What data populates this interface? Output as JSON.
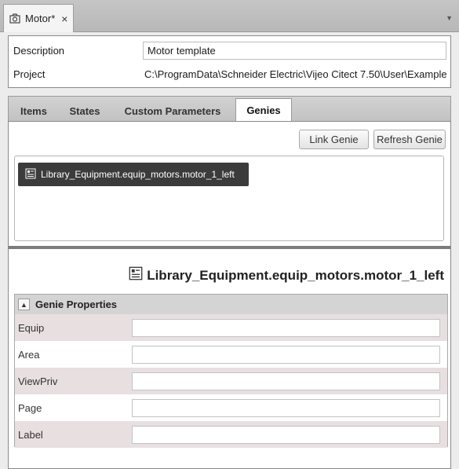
{
  "document_tab": {
    "title": "Motor*",
    "close": "×"
  },
  "info": {
    "description_label": "Description",
    "description_value": "Motor template",
    "project_label": "Project",
    "project_value": "C:\\ProgramData\\Schneider Electric\\Vijeo Citect 7.50\\User\\Example"
  },
  "tabs": [
    {
      "label": "Items"
    },
    {
      "label": "States"
    },
    {
      "label": "Custom Parameters"
    },
    {
      "label": "Genies"
    }
  ],
  "active_tab": "Genies",
  "buttons": {
    "link_genie": "Link Genie",
    "refresh_genie": "Refresh Genie"
  },
  "genie_list": [
    {
      "label": "Library_Equipment.equip_motors.motor_1_left"
    }
  ],
  "selected_genie": "Library_Equipment.equip_motors.motor_1_left",
  "genie_properties": {
    "header": "Genie Properties",
    "rows": [
      {
        "label": "Equip",
        "value": ""
      },
      {
        "label": "Area",
        "value": ""
      },
      {
        "label": "ViewPriv",
        "value": ""
      },
      {
        "label": "Page",
        "value": ""
      },
      {
        "label": "Label",
        "value": ""
      }
    ]
  },
  "colors": {
    "selected_item_bg": "#3b3b3b",
    "odd_row_bg": "#e8dfe1",
    "header_bg": "#d4d4d4"
  }
}
